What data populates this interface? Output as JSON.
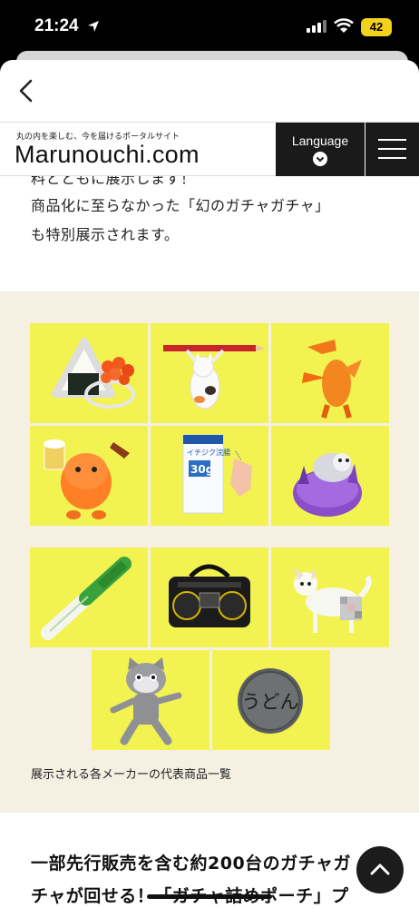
{
  "status_bar": {
    "time": "21:24",
    "battery": "42"
  },
  "site": {
    "tagline": "丸の内を楽しむ、今を届けるポータルサイト",
    "logo": "Marunouchi.com",
    "language_label": "Language"
  },
  "article": {
    "partial_line": "料とともに展示します！",
    "para_line1": "商品化に至らなかった「幻のガチャガチャ」",
    "para_line2": "も特別展示されます。",
    "caption": "展示される各メーカーの代表商品一覧",
    "heading_line1": "一部先行販売を含む約200台のガチャガ",
    "heading_line2": "チャが回せる！「ガチャ詰めポーチ」プ"
  },
  "products": {
    "milk_carton_label": "イチジク浣腸",
    "milk_carton_size": "30g",
    "udon_text": "うどん"
  },
  "colors": {
    "tile_yellow": "#f2f251",
    "beige": "#f6f0e3",
    "header_dark": "#1a1a1a"
  }
}
